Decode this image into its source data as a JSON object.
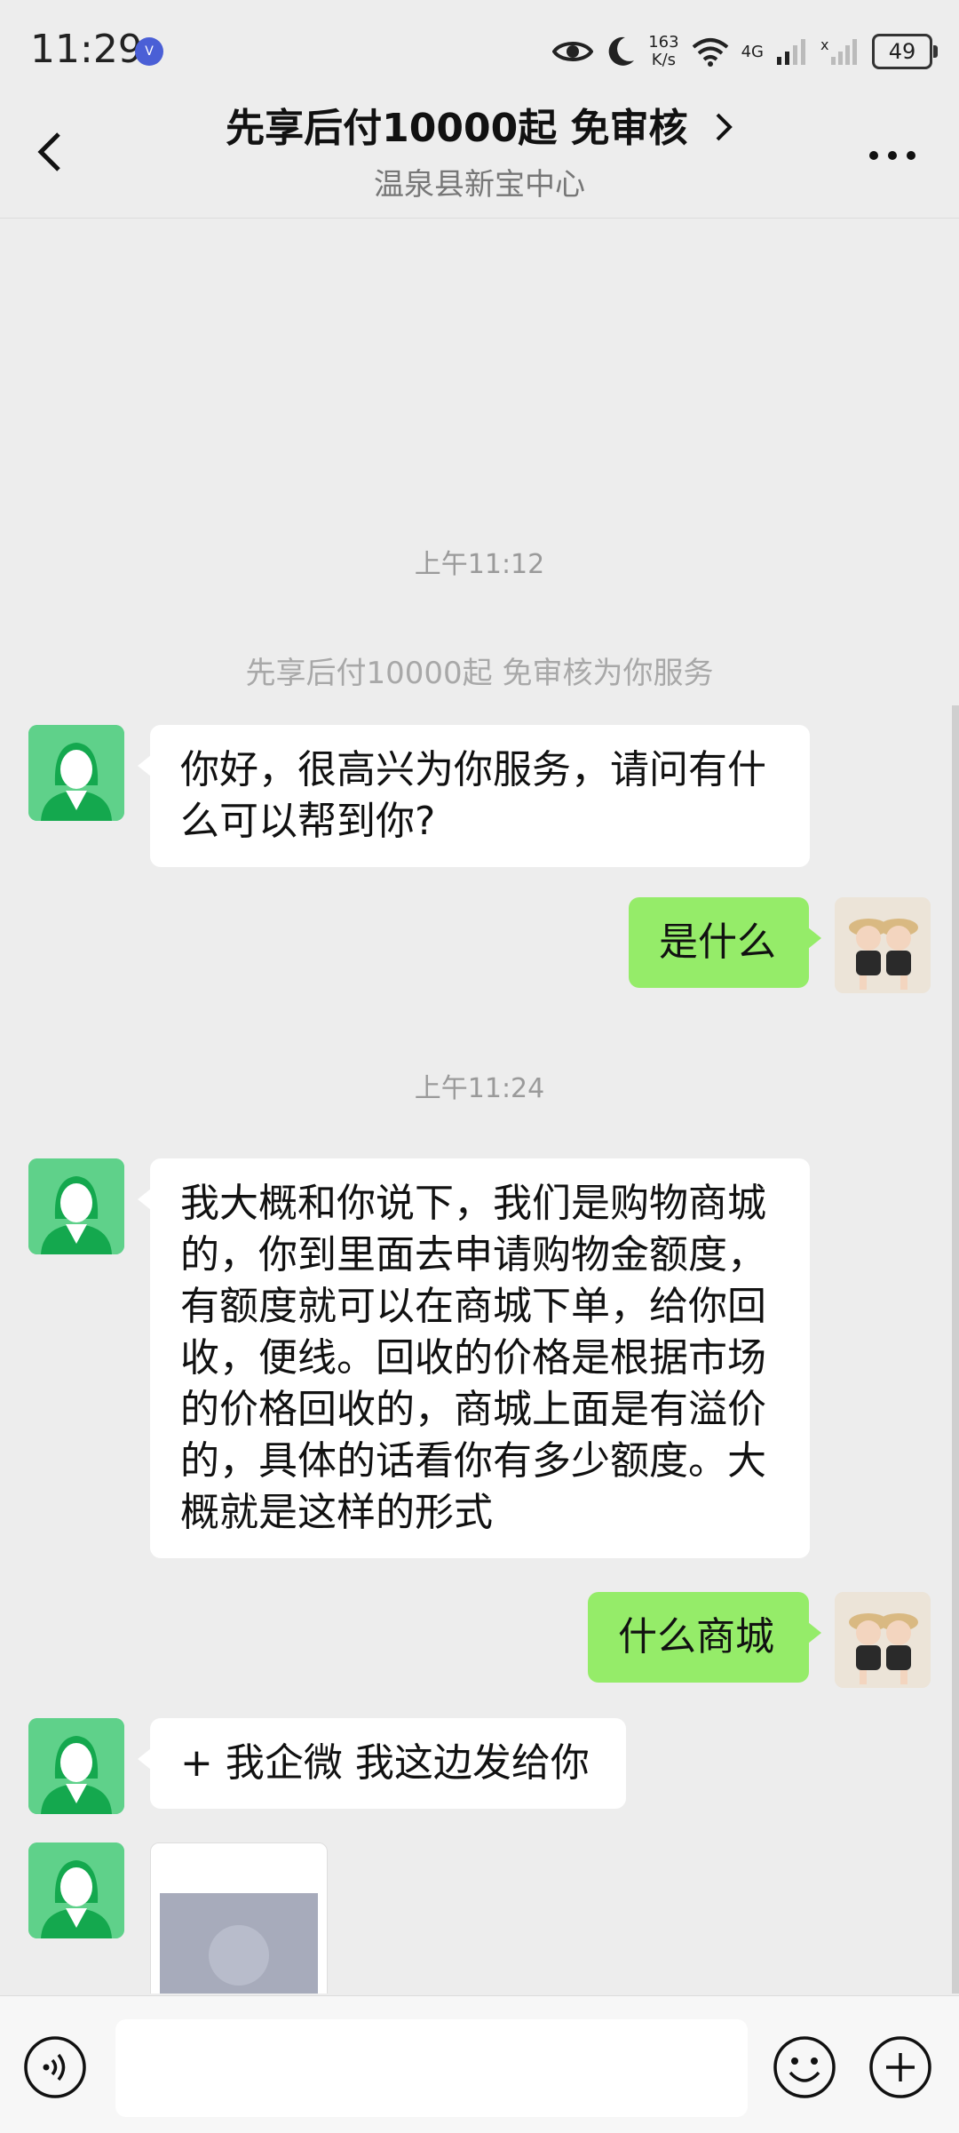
{
  "status_bar": {
    "time": "11:29",
    "net_speed_value": "163",
    "net_speed_unit": "K/s",
    "network": "4G",
    "battery": "49"
  },
  "header": {
    "title": "先享后付10000起 免审核",
    "subtitle": "温泉县新宝中心"
  },
  "messages": {
    "time_1": "上午11:12",
    "system_notice": "先享后付10000起 免审核为你服务",
    "msg_1": "你好，很高兴为你服务，请问有什么可以帮到你?",
    "msg_2": "是什么",
    "time_2": "上午11:24",
    "msg_3": "我大概和你说下，我们是购物商城的，你到里面去申请购物金额度，有额度就可以在商城下单，给你回收，便线。回收的价格是根据市场的价格回收的，商城上面是有溢价的，具体的话看你有多少额度。大概就是这样的形式",
    "msg_4": "什么商城",
    "msg_5": "+ 我企微  我这边发给你"
  },
  "input_bar": {
    "value": ""
  },
  "icons": {
    "back": "chevron-left-icon",
    "title_arrow": "chevron-right-icon",
    "more": "more-icon",
    "voice": "voice-icon",
    "emoji": "emoji-icon",
    "plus": "plus-icon"
  },
  "colors": {
    "sent_bubble": "#95ec69",
    "received_bubble": "#ffffff",
    "background": "#ededed",
    "agent_avatar": "#5fd18a"
  }
}
